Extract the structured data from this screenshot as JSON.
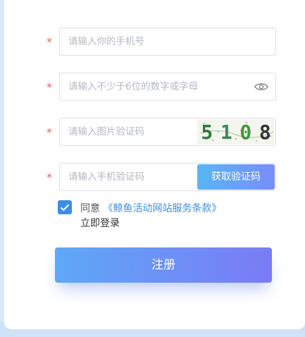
{
  "form": {
    "required_mark": "*",
    "phone_placeholder": "请输入你的手机号",
    "password_placeholder": "请输入不少于6位的数字或字母",
    "captcha_placeholder": "请输入图片验证码",
    "captcha_code": [
      "5",
      "1",
      "0",
      "8"
    ],
    "sms_placeholder": "请输入手机验证码",
    "sms_button_label": "获取验证码",
    "agree_prefix": "同意",
    "agree_link": "《鲸鱼活动网站服务条款》",
    "agree_checked": true,
    "login_link": "立即登录",
    "register_label": "注册"
  },
  "colors": {
    "accent": "#3a8ee6",
    "required": "#f25c5c",
    "button_gradient_start": "#5ea8f7",
    "button_gradient_end": "#7b7bf5"
  }
}
